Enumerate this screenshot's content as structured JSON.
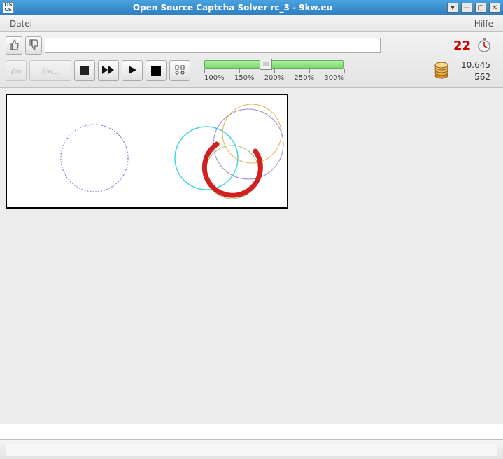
{
  "window": {
    "title": "Open Source Captcha Solver rc_3 - 9kw.eu"
  },
  "menu": {
    "file": "Datei",
    "help": "Hilfe"
  },
  "answer": {
    "value": "",
    "placeholder": ""
  },
  "countdown": "22",
  "stats": {
    "balance": "10.645",
    "solved": "562"
  },
  "zoom": {
    "labels": [
      "100%",
      "150%",
      "200%",
      "250%",
      "300%"
    ],
    "position_percent": 44
  },
  "icons": {
    "thumbs_up": "thumbs-up-icon",
    "thumbs_down": "thumbs-down-icon",
    "skip": "skip-icon",
    "skip_all": "skip-all-icon",
    "stop_small": "stop-small-icon",
    "fast_forward": "fast-forward-icon",
    "play": "play-icon",
    "stop": "stop-icon",
    "settings": "settings-icon",
    "timer": "timer-icon",
    "coins": "coins-icon"
  }
}
